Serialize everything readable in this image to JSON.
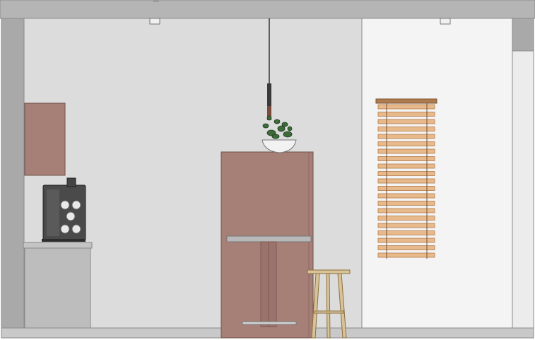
{
  "drawing": {
    "view": "interior-elevation",
    "colors": {
      "ceiling_band": "#b5b5b5",
      "wall_left": "#dcdcdc",
      "wall_right": "#f4f4f4",
      "column": "#a9a9a9",
      "floor": "#c9c9c9",
      "cabinet": "#a67f77",
      "counter": "#bdbdbd",
      "coffee_machine": "#4a4a4a",
      "blind_slat": "#e8b98a",
      "blind_edge": "#b07b4c",
      "stool_wood": "#d8c398",
      "plant_green": "#3d6b3a",
      "bowl": "#f2f2f2",
      "pendant_cord": "#333333"
    },
    "elements": {
      "ceiling_spotlight_left": {
        "icon": "spotlight-icon"
      },
      "ceiling_spotlight_right": {
        "icon": "spotlight-icon"
      },
      "pendant_lamp": {
        "icon": "pendant-lamp-icon"
      },
      "wall_cabinet": {
        "icon": "cabinet-icon"
      },
      "coffee_machine": {
        "icon": "coffee-machine-icon"
      },
      "mug_rack": {
        "icon": "mug-icon"
      },
      "base_counter": {
        "icon": "counter-icon"
      },
      "tall_cabinet": {
        "icon": "cabinet-icon"
      },
      "bar_table": {
        "icon": "table-icon"
      },
      "potted_plant": {
        "icon": "plant-icon"
      },
      "window_blind": {
        "icon": "blind-icon"
      },
      "bar_stool": {
        "icon": "stool-icon"
      },
      "floor": {
        "icon": "floor-icon"
      }
    }
  }
}
